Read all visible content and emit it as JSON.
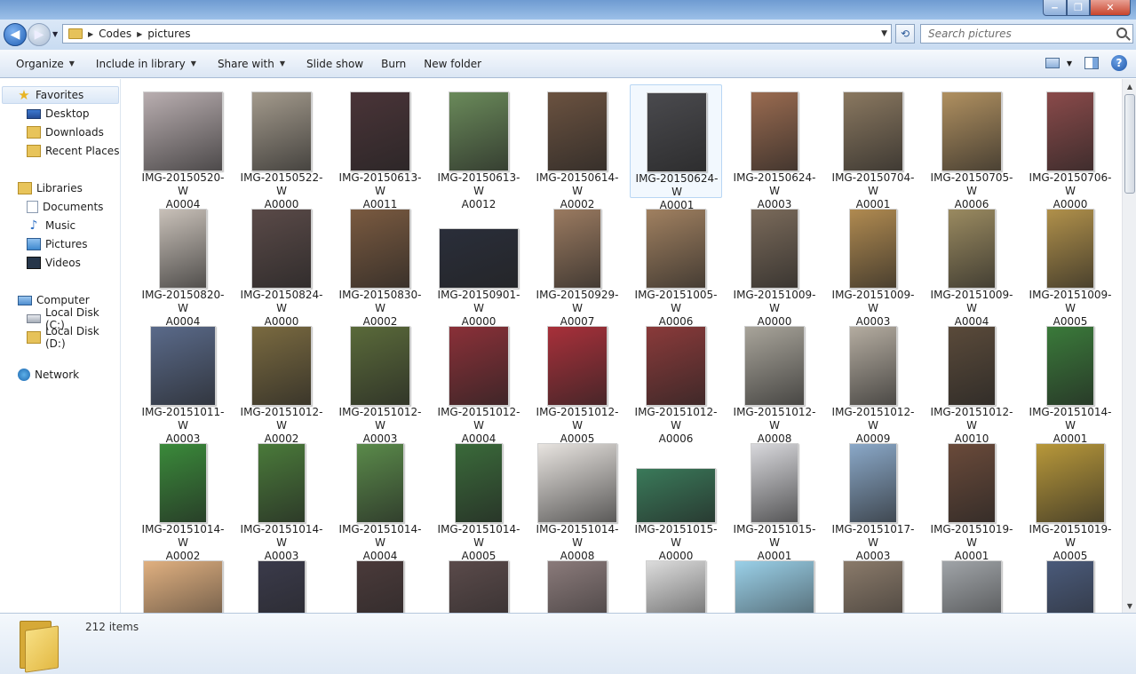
{
  "window": {
    "minimize": "‒",
    "maximize": "❐",
    "close": "✕"
  },
  "address": {
    "crumbs": [
      "Codes",
      "pictures"
    ],
    "search_placeholder": "Search pictures"
  },
  "toolbar": {
    "organize": "Organize",
    "include_in_library": "Include in library",
    "share_with": "Share with",
    "slide_show": "Slide show",
    "burn": "Burn",
    "new_folder": "New folder"
  },
  "nav": {
    "favorites": "Favorites",
    "desktop": "Desktop",
    "downloads": "Downloads",
    "recent_places": "Recent Places",
    "libraries": "Libraries",
    "documents": "Documents",
    "music": "Music",
    "pictures": "Pictures",
    "videos": "Videos",
    "computer": "Computer",
    "local_c": "Local Disk (C:)",
    "local_d": "Local Disk (D:)",
    "network": "Network"
  },
  "files": [
    {
      "l1": "IMG-20150520-W",
      "l2": "A0004",
      "color": "#b9aeb0"
    },
    {
      "l1": "IMG-20150522-W",
      "l2": "A0000",
      "color": "#a39a8c"
    },
    {
      "l1": "IMG-20150613-W",
      "l2": "A0011",
      "color": "#4a3438"
    },
    {
      "l1": "IMG-20150613-W",
      "l2": "A0012",
      "color": "#6a8a5a"
    },
    {
      "l1": "IMG-20150614-W",
      "l2": "A0002",
      "color": "#6b5240"
    },
    {
      "l1": "IMG-20150624-W",
      "l2": "A0001",
      "color": "#4a4a4e"
    },
    {
      "l1": "IMG-20150624-W",
      "l2": "A0003",
      "color": "#9a6b50"
    },
    {
      "l1": "IMG-20150704-W",
      "l2": "A0001",
      "color": "#8a7860"
    },
    {
      "l1": "IMG-20150705-W",
      "l2": "A0006",
      "color": "#b09060"
    },
    {
      "l1": "IMG-20150706-W",
      "l2": "A0000",
      "color": "#8a4a4a"
    },
    {
      "l1": "IMG-20150820-W",
      "l2": "A0004",
      "color": "#c8c0b8"
    },
    {
      "l1": "IMG-20150824-W",
      "l2": "A0000",
      "color": "#5a4a48"
    },
    {
      "l1": "IMG-20150830-W",
      "l2": "A0002",
      "color": "#7a5a40"
    },
    {
      "l1": "IMG-20150901-W",
      "l2": "A0000",
      "color": "#2a2e3a"
    },
    {
      "l1": "IMG-20150929-W",
      "l2": "A0007",
      "color": "#9a7a60"
    },
    {
      "l1": "IMG-20151005-W",
      "l2": "A0006",
      "color": "#a08060"
    },
    {
      "l1": "IMG-20151009-W",
      "l2": "A0000",
      "color": "#7a6a5a"
    },
    {
      "l1": "IMG-20151009-W",
      "l2": "A0003",
      "color": "#b08a50"
    },
    {
      "l1": "IMG-20151009-W",
      "l2": "A0004",
      "color": "#9a8a60"
    },
    {
      "l1": "IMG-20151009-W",
      "l2": "A0005",
      "color": "#b0904a"
    },
    {
      "l1": "IMG-20151011-W",
      "l2": "A0003",
      "color": "#5a6a8a"
    },
    {
      "l1": "IMG-20151012-W",
      "l2": "A0002",
      "color": "#7a6a40"
    },
    {
      "l1": "IMG-20151012-W",
      "l2": "A0003",
      "color": "#5a6a3a"
    },
    {
      "l1": "IMG-20151012-W",
      "l2": "A0004",
      "color": "#8a3038"
    },
    {
      "l1": "IMG-20151012-W",
      "l2": "A0005",
      "color": "#a8303a"
    },
    {
      "l1": "IMG-20151012-W",
      "l2": "A0006",
      "color": "#8a3a3a"
    },
    {
      "l1": "IMG-20151012-W",
      "l2": "A0008",
      "color": "#a8a49a"
    },
    {
      "l1": "IMG-20151012-W",
      "l2": "A0009",
      "color": "#b4aca0"
    },
    {
      "l1": "IMG-20151012-W",
      "l2": "A0010",
      "color": "#5a4a3a"
    },
    {
      "l1": "IMG-20151014-W",
      "l2": "A0001",
      "color": "#3a7a3a"
    },
    {
      "l1": "IMG-20151014-W",
      "l2": "A0002",
      "color": "#3a8a3a"
    },
    {
      "l1": "IMG-20151014-W",
      "l2": "A0003",
      "color": "#4a7a3a"
    },
    {
      "l1": "IMG-20151014-W",
      "l2": "A0004",
      "color": "#5a8a4a"
    },
    {
      "l1": "IMG-20151014-W",
      "l2": "A0005",
      "color": "#3a6a3a"
    },
    {
      "l1": "IMG-20151014-W",
      "l2": "A0008",
      "color": "#e8e4e0"
    },
    {
      "l1": "IMG-20151015-W",
      "l2": "A0000",
      "color": "#3a7a5a"
    },
    {
      "l1": "IMG-20151015-W",
      "l2": "A0001",
      "color": "#d8d8dc"
    },
    {
      "l1": "IMG-20151017-W",
      "l2": "A0003",
      "color": "#8aa8c8"
    },
    {
      "l1": "IMG-20151019-W",
      "l2": "A0001",
      "color": "#6a4a3a"
    },
    {
      "l1": "IMG-20151019-W",
      "l2": "A0005",
      "color": "#b8983a"
    },
    {
      "l1": "",
      "l2": "",
      "color": "#e0b080"
    },
    {
      "l1": "",
      "l2": "",
      "color": "#3a3a4a"
    },
    {
      "l1": "",
      "l2": "",
      "color": "#4a3a3a"
    },
    {
      "l1": "",
      "l2": "",
      "color": "#5a4a4a"
    },
    {
      "l1": "",
      "l2": "",
      "color": "#8a7a7a"
    },
    {
      "l1": "",
      "l2": "",
      "color": "#dcdcdc"
    },
    {
      "l1": "",
      "l2": "",
      "color": "#9ad0e8"
    },
    {
      "l1": "",
      "l2": "",
      "color": "#8a7a6a"
    },
    {
      "l1": "",
      "l2": "",
      "color": "#a0a4a8"
    },
    {
      "l1": "",
      "l2": "",
      "color": "#4a5a7a"
    }
  ],
  "status": {
    "items": "212 items"
  }
}
